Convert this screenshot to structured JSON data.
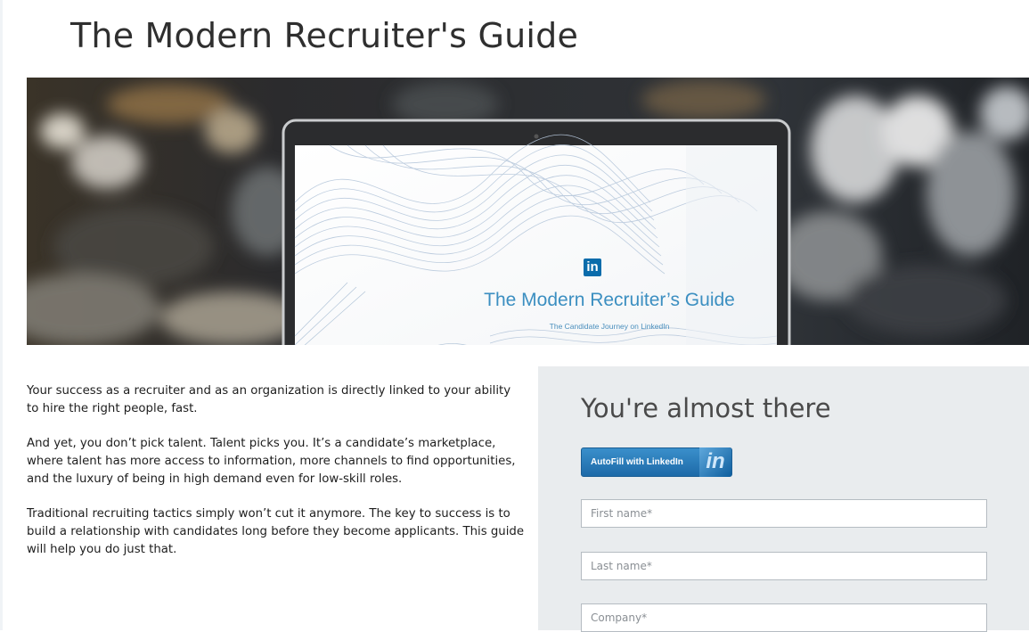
{
  "page": {
    "title": "The Modern Recruiter's Guide"
  },
  "hero": {
    "logo_text": "in",
    "screen_title": "The Modern Recruiter’s Guide",
    "screen_subtitle": "The Candidate Journey on LinkedIn"
  },
  "body_copy": {
    "paragraphs": [
      "Your success as a recruiter and as an organization is directly linked to your ability to hire the right people, fast.",
      "And yet, you don’t pick talent. Talent picks you. It’s a candidate’s marketplace, where talent has more access to information, more channels to find opportunities, and the luxury of being in high demand even for low-skill roles.",
      "Traditional recruiting tactics simply won’t cut it anymore. The key to success is to build a relationship with candidates long before they become applicants. This guide will help you do just that."
    ]
  },
  "form": {
    "title": "You're almost there",
    "autofill": {
      "prefix": "AutoFill with ",
      "brand": "LinkedIn",
      "badge": "in"
    },
    "fields": {
      "first_name": {
        "value": "",
        "placeholder": "First name*"
      },
      "last_name": {
        "value": "",
        "placeholder": "Last name*"
      },
      "company": {
        "value": "",
        "placeholder": "Company*"
      }
    }
  },
  "colors": {
    "accent_blue": "#3c8fc1",
    "linkedin_blue": "#0a6cab",
    "form_panel": "#e9ecee"
  }
}
